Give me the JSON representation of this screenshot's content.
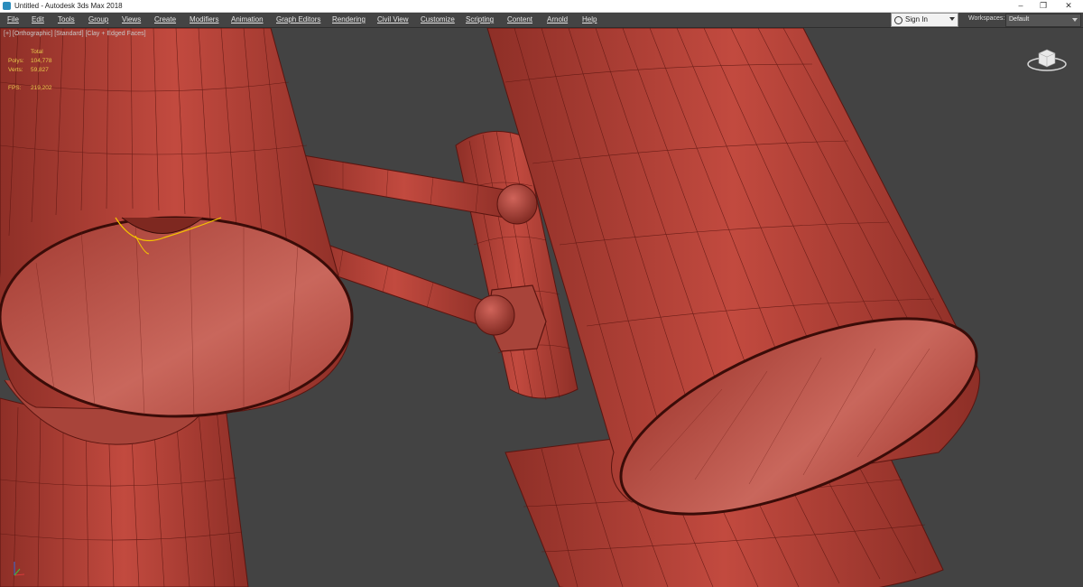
{
  "window": {
    "title": "Untitled - Autodesk 3ds Max 2018",
    "minimize_icon": "–",
    "restore_icon": "❐",
    "close_icon": "✕"
  },
  "menu": [
    "File",
    "Edit",
    "Tools",
    "Group",
    "Views",
    "Create",
    "Modifiers",
    "Animation",
    "Graph Editors",
    "Rendering",
    "Civil View",
    "Customize",
    "Scripting",
    "Content",
    "Arnold",
    "Help"
  ],
  "signin": {
    "label": "Sign In"
  },
  "workspaces": {
    "label": "Workspaces:",
    "value": "Default"
  },
  "viewport": {
    "label": "[+] [Orthographic] [Standard] [Clay + Edged Faces]",
    "stats": {
      "header": "Total",
      "polys_label": "Polys:",
      "polys_value": "104,778",
      "verts_label": "Verts:",
      "verts_value": "59,827",
      "fps_label": "FPS:",
      "fps_value": "219,202"
    }
  },
  "colors": {
    "viewport_bg": "#434343",
    "clay": "#b8453b",
    "clay_dark": "#8e2f27",
    "wire": "#5a1510",
    "stats_text": "#e8c84c",
    "selection": "#f5c400"
  },
  "icons": [
    "app-icon",
    "person-icon",
    "dropdown-icon",
    "viewcube-icon",
    "axis-tripod-icon"
  ]
}
